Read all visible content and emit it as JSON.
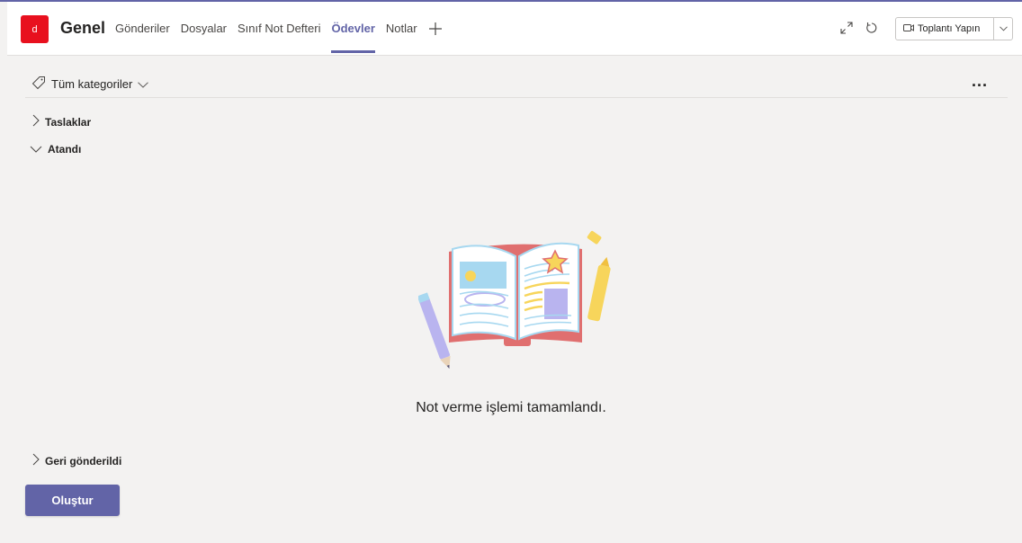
{
  "header": {
    "avatar_letter": "d",
    "channel_name": "Genel",
    "tabs": [
      {
        "label": "Gönderiler",
        "active": false
      },
      {
        "label": "Dosyalar",
        "active": false
      },
      {
        "label": "Sınıf Not Defteri",
        "active": false
      },
      {
        "label": "Ödevler",
        "active": true
      },
      {
        "label": "Notlar",
        "active": false
      }
    ],
    "add_tab_icon": "plus-icon",
    "expand_icon": "expand-icon",
    "refresh_icon": "refresh-icon",
    "meet_button_label": "Toplantı Yapın",
    "meet_icon": "video-camera-icon",
    "accent_color": "#6264a7",
    "avatar_color": "#e8101e"
  },
  "filter": {
    "label": "Tüm kategoriler",
    "icon": "tag-icon",
    "more_label": "..."
  },
  "sections": {
    "drafts": "Taslaklar",
    "assigned": "Atandı",
    "returned": "Geri gönderildi"
  },
  "empty_state": {
    "message": "Not verme işlemi tamamlandı.",
    "illustration": "open-book-illustration"
  },
  "actions": {
    "create_label": "Oluştur"
  }
}
